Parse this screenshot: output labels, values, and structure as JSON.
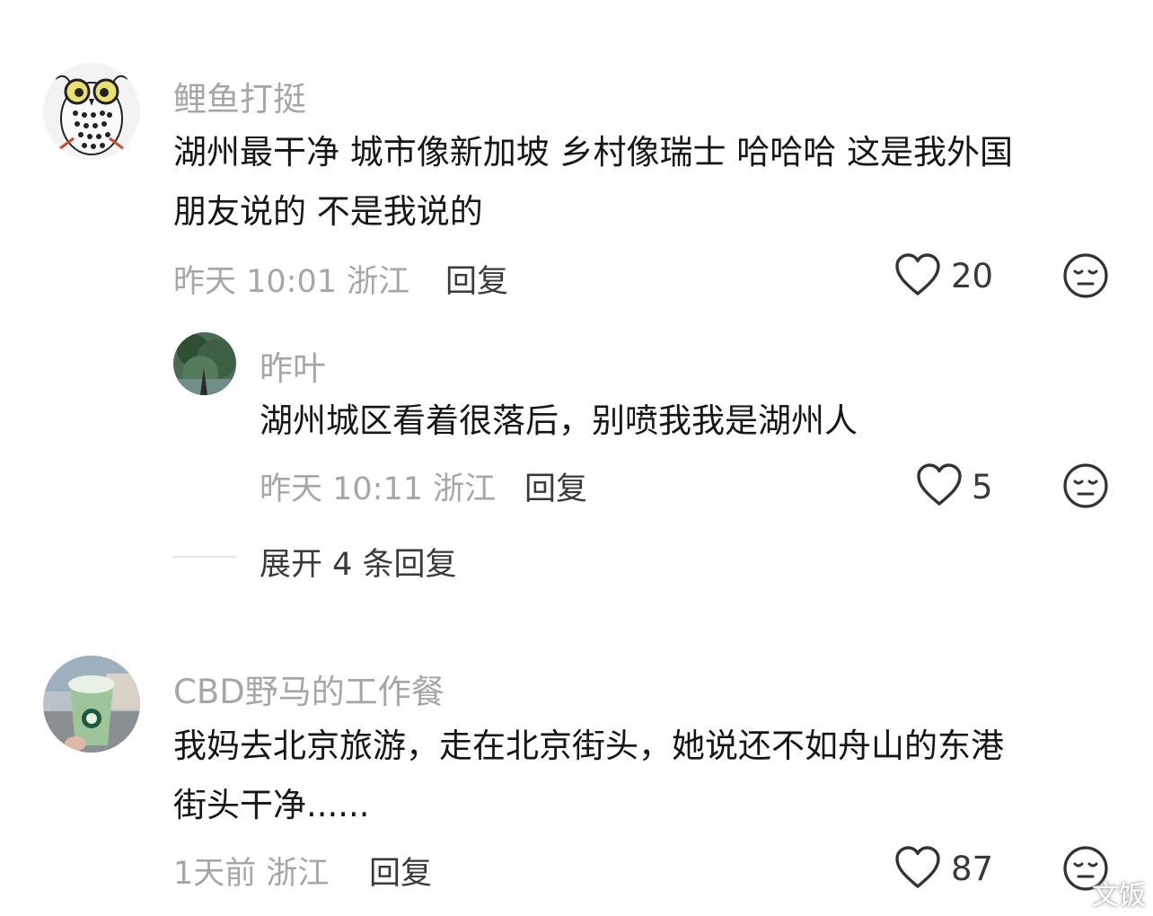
{
  "comments": [
    {
      "username": "鲤鱼打挺",
      "lines": [
        "湖州最干净 城市像新加坡 乡村像瑞士 哈哈哈 这是我外国",
        "朋友说的 不是我说的"
      ],
      "time_location": "昨天 10:01 浙江",
      "reply_label": "回复",
      "likes": "20",
      "avatar_icon": "owl-drawing-avatar"
    },
    {
      "username": "昨叶",
      "lines": [
        "湖州城区看着很落后，别喷我我是湖州人"
      ],
      "time_location": "昨天 10:11 浙江",
      "reply_label": "回复",
      "likes": "5",
      "avatar_icon": "tree-photo-avatar"
    },
    {
      "username": "CBD野马的工作餐",
      "lines": [
        "我妈去北京旅游，走在北京街头，她说还不如舟山的东港",
        "街头干净......"
      ],
      "time_location": "1天前 浙江",
      "reply_label": "回复",
      "likes": "87",
      "avatar_icon": "starbucks-drink-avatar"
    }
  ],
  "expand_replies_label": "展开 4 条回复",
  "watermark": "文饭",
  "colors": {
    "text": "#161616",
    "secondary": "#a6a6a6",
    "action": "#3a3a3a"
  }
}
